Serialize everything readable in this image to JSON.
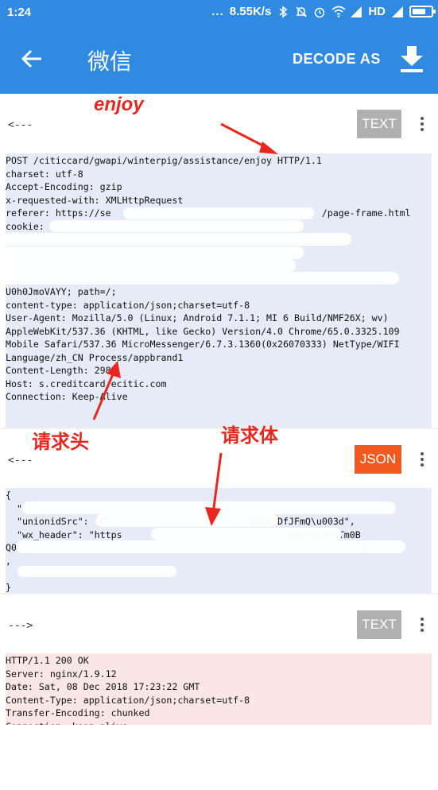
{
  "status_bar": {
    "time": "1:24",
    "dots": "...",
    "speed": "8.55K/s",
    "network": "HD"
  },
  "app_bar": {
    "title": "微信",
    "decode_label": "DECODE AS",
    "icons": {
      "back": "arrow-left-icon",
      "download": "download-icon"
    }
  },
  "annotations": {
    "enjoy": "enjoy",
    "request_header": "请求头",
    "request_body": "请求体"
  },
  "request_header": {
    "direction": "<---",
    "type": "TEXT",
    "lines": [
      "POST /citiccard/gwapi/winterpig/assistance/enjoy HTTP/1.1",
      "charset: utf-8",
      "Accept-Encoding: gzip",
      "x-requested-with: XMLHttpRequest",
      "referer: https://se                                      /page-frame.html",
      "cookie:",
      "",
      "",
      "",
      "",
      "U0h0JmoVAYY; path=/;",
      "content-type: application/json;charset=utf-8",
      "User-Agent: Mozilla/5.0 (Linux; Android 7.1.1; MI 6 Build/NMF26X; wv)",
      "AppleWebKit/537.36 (KHTML, like Gecko) Version/4.0 Chrome/65.0.3325.109",
      "Mobile Safari/537.36 MicroMessenger/6.7.3.1360(0x26070333) NetType/WIFI",
      "Language/zh_CN Process/appbrand1",
      "Content-Length: 298",
      "Host: s.creditcard.ecitic.com",
      "Connection: Keep-Alive"
    ]
  },
  "request_body": {
    "direction": "<---",
    "type": "JSON",
    "lines": [
      "{",
      "  \"",
      "  \"unionidSrc\": \"C                          yGBU3DfJFmQ\\u003d\",",
      "  \"wx_header\": \"https                              Hqw9gU7QzTm0B",
      "Q0                                                              2\"",
      ",",
      "",
      "}"
    ]
  },
  "response": {
    "direction": "--->",
    "type": "TEXT",
    "lines": [
      "HTTP/1.1 200 OK",
      "Server: nginx/1.9.12",
      "Date: Sat, 08 Dec 2018 17:23:22 GMT",
      "Content-Type: application/json;charset=utf-8",
      "Transfer-Encoding: chunked",
      "Connection: keep-alive"
    ]
  },
  "colors": {
    "primary": "#2f8ae0",
    "badge_text": "#b0b0b0",
    "badge_json": "#f05a1e",
    "annotation": "#e8281e"
  }
}
